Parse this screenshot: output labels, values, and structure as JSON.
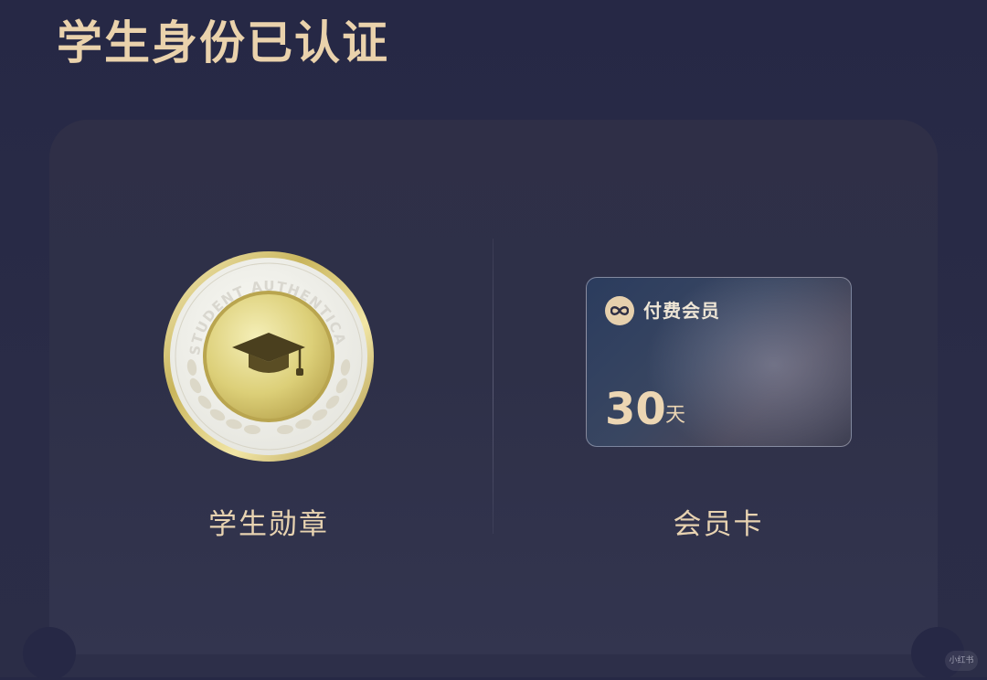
{
  "header": {
    "title": "学生身份已认证"
  },
  "left_item": {
    "badge_text": "STUDENT AUTHENTICA",
    "badge_icon": "graduation-cap-icon",
    "label": "学生勋章"
  },
  "right_item": {
    "card": {
      "icon": "infinity-icon",
      "title": "付费会员",
      "days": "30",
      "unit": "天"
    },
    "label": "会员卡"
  },
  "watermark": "小红书",
  "colors": {
    "background": "#262845",
    "accent_gold": "#ead2ac",
    "panel": "#2f2f47"
  }
}
